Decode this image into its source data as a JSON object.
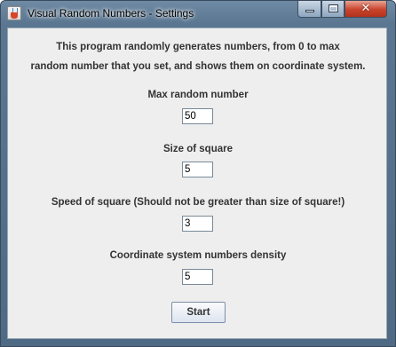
{
  "window": {
    "title": "Visual Random Numbers - Settings"
  },
  "controls": {
    "minimize_icon": "minimize-icon",
    "maximize_icon": "maximize-icon",
    "close_icon": "close-icon",
    "close_glyph": "✕"
  },
  "intro": {
    "line1": "This program randomly generates numbers, from 0 to max",
    "line2": "random number that you set, and shows them on coordinate system."
  },
  "fields": {
    "max_random": {
      "label": "Max random number",
      "value": "50"
    },
    "square_size": {
      "label": "Size of square",
      "value": "5"
    },
    "square_speed": {
      "label": "Speed of square (Should not be greater than size of square!)",
      "value": "3"
    },
    "density": {
      "label": "Coordinate system numbers density",
      "value": "5"
    }
  },
  "start_button": {
    "label": "Start"
  }
}
